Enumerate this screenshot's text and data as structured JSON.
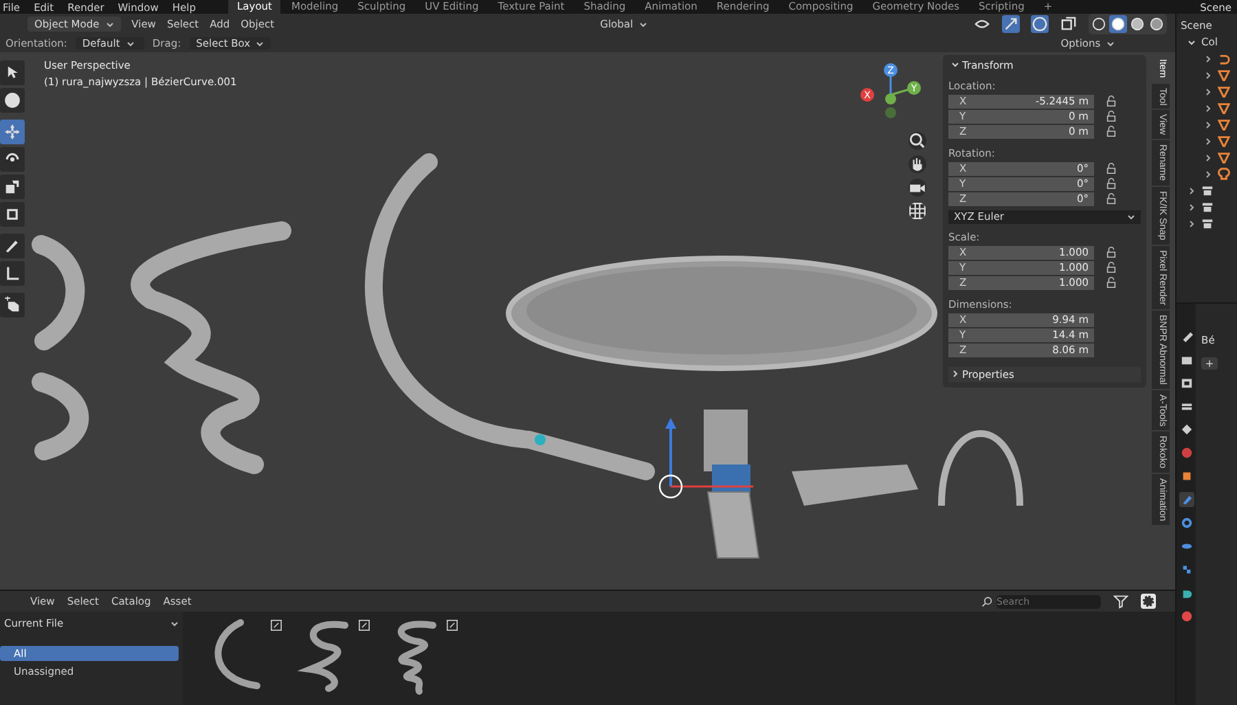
{
  "top_menu": [
    "File",
    "Edit",
    "Render",
    "Window",
    "Help"
  ],
  "workspaces": [
    {
      "label": "Layout",
      "selected": true
    },
    {
      "label": "Modeling",
      "selected": false
    },
    {
      "label": "Sculpting",
      "selected": false
    },
    {
      "label": "UV Editing",
      "selected": false
    },
    {
      "label": "Texture Paint",
      "selected": false
    },
    {
      "label": "Shading",
      "selected": false
    },
    {
      "label": "Animation",
      "selected": false
    },
    {
      "label": "Rendering",
      "selected": false
    },
    {
      "label": "Compositing",
      "selected": false
    },
    {
      "label": "Geometry Nodes",
      "selected": false
    },
    {
      "label": "Scripting",
      "selected": false
    }
  ],
  "add_workspace": "+",
  "scene_selector": "Scene",
  "header": {
    "mode": "Object Mode",
    "menus": [
      "View",
      "Select",
      "Add",
      "Object"
    ],
    "transform_orientation": "Global",
    "toggles": [
      {
        "kind": "visibility",
        "on": false
      },
      {
        "kind": "gizmo",
        "on": true
      },
      {
        "kind": "overlay",
        "on": true
      },
      {
        "kind": "xray",
        "on": false
      }
    ],
    "shading": [
      {
        "kind": "wireframe",
        "selected": false
      },
      {
        "kind": "solid",
        "selected": true
      },
      {
        "kind": "material",
        "selected": false
      },
      {
        "kind": "rendered",
        "selected": false
      }
    ]
  },
  "tool_settings": {
    "orientation_label": "Orientation:",
    "orientation": "Default",
    "drag_label": "Drag:",
    "drag": "Select Box",
    "options": "Options"
  },
  "viewport": {
    "view_name": "User Perspective",
    "object_info": "(1) rura_najwyzsza | BézierCurve.001",
    "gizmo_axes": [
      "Z",
      "Y",
      "X"
    ]
  },
  "tools": [
    {
      "kind": "select",
      "selected": false
    },
    {
      "kind": "cursor",
      "selected": false
    },
    {
      "kind": "move",
      "selected": true
    },
    {
      "kind": "rotate",
      "selected": false
    },
    {
      "kind": "scale",
      "selected": false
    },
    {
      "kind": "transform",
      "selected": false
    },
    {
      "kind": "annotate",
      "selected": false
    },
    {
      "kind": "measure",
      "selected": false
    },
    {
      "kind": "add_cube",
      "selected": false
    }
  ],
  "sidebar_tabs": [
    {
      "label": "Item",
      "selected": true
    },
    {
      "label": "Tool",
      "selected": false
    },
    {
      "label": "View",
      "selected": false
    },
    {
      "label": "Rename",
      "selected": false
    },
    {
      "label": "FK/IK Snap",
      "selected": false
    },
    {
      "label": "Pixel Render",
      "selected": false
    },
    {
      "label": "BNPR Abnormal",
      "selected": false
    },
    {
      "label": "A-Tools",
      "selected": false
    },
    {
      "label": "Rokoko",
      "selected": false
    },
    {
      "label": "Animation",
      "selected": false
    }
  ],
  "transform_panel": {
    "title": "Transform",
    "expanded": true,
    "groups": [
      {
        "kind": "vector",
        "label": "Location:",
        "lockable": true,
        "rows": [
          {
            "axis": "X",
            "value": "-5.2445 m"
          },
          {
            "axis": "Y",
            "value": "0 m"
          },
          {
            "axis": "Z",
            "value": "0 m"
          }
        ]
      },
      {
        "kind": "vector",
        "label": "Rotation:",
        "lockable": true,
        "rows": [
          {
            "axis": "X",
            "value": "0°"
          },
          {
            "axis": "Y",
            "value": "0°"
          },
          {
            "axis": "Z",
            "value": "0°"
          }
        ]
      },
      {
        "kind": "dropdown",
        "value": "XYZ Euler"
      },
      {
        "kind": "vector",
        "label": "Scale:",
        "lockable": true,
        "rows": [
          {
            "axis": "X",
            "value": "1.000"
          },
          {
            "axis": "Y",
            "value": "1.000"
          },
          {
            "axis": "Z",
            "value": "1.000"
          }
        ]
      },
      {
        "kind": "vector",
        "label": "Dimensions:",
        "lockable": false,
        "rows": [
          {
            "axis": "X",
            "value": "9.94 m"
          },
          {
            "axis": "Y",
            "value": "14.4 m"
          },
          {
            "axis": "Z",
            "value": "8.06 m"
          }
        ]
      }
    ]
  },
  "properties_panel": {
    "title": "Properties",
    "expanded": false
  },
  "outliner": {
    "scene": "Scene",
    "collection": {
      "label": "Col",
      "expanded": true,
      "children": [
        {
          "kind": "curve",
          "expanded": false
        },
        {
          "kind": "mesh",
          "expanded": false
        },
        {
          "kind": "mesh",
          "expanded": false
        },
        {
          "kind": "mesh",
          "expanded": false
        },
        {
          "kind": "mesh",
          "expanded": false
        },
        {
          "kind": "mesh",
          "expanded": false
        },
        {
          "kind": "mesh",
          "expanded": false
        },
        {
          "kind": "light",
          "expanded": false
        }
      ]
    },
    "collections": [
      {
        "kind": "collection",
        "expanded": false
      },
      {
        "kind": "collection",
        "expanded": false
      },
      {
        "kind": "collection",
        "expanded": false
      }
    ]
  },
  "properties_editor": {
    "object_name": "Bé",
    "add": "+",
    "tabs": [
      {
        "kind": "tool",
        "selected": false
      },
      {
        "kind": "render",
        "selected": false
      },
      {
        "kind": "output",
        "selected": false
      },
      {
        "kind": "view_layer",
        "selected": false
      },
      {
        "kind": "scene",
        "selected": false
      },
      {
        "kind": "world",
        "selected": false
      },
      {
        "kind": "object",
        "selected": false
      },
      {
        "kind": "modifier",
        "selected": true
      },
      {
        "kind": "particles",
        "selected": false
      },
      {
        "kind": "physics",
        "selected": false
      },
      {
        "kind": "constraint",
        "selected": false
      },
      {
        "kind": "data",
        "selected": false
      },
      {
        "kind": "material",
        "selected": false
      }
    ]
  },
  "asset_browser": {
    "menus": [
      "View",
      "Select",
      "Catalog",
      "Asset"
    ],
    "library": "Current File",
    "catalogs": [
      {
        "label": "All",
        "selected": true
      },
      {
        "label": "Unassigned",
        "selected": false
      }
    ],
    "search": {
      "placeholder": "Search"
    },
    "assets": [
      {
        "kind": "arc"
      },
      {
        "kind": "coil_small"
      },
      {
        "kind": "coil_tall"
      }
    ]
  }
}
